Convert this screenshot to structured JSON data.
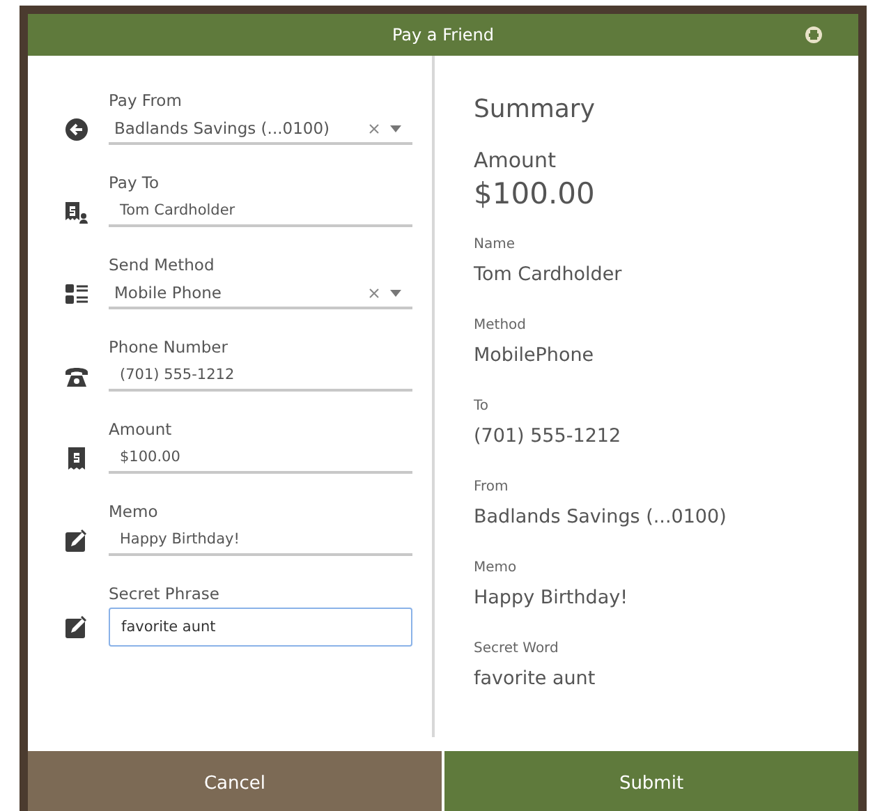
{
  "window": {
    "title": "Pay a Friend"
  },
  "fields": [
    {
      "label": "Pay From",
      "value": "Badlands Savings (...0100)",
      "kind": "select",
      "focused": false
    },
    {
      "label": "Pay To",
      "value": "Tom Cardholder",
      "kind": "text",
      "focused": false
    },
    {
      "label": "Send Method",
      "value": "Mobile Phone",
      "kind": "select",
      "focused": false
    },
    {
      "label": "Phone Number",
      "value": "(701) 555-1212",
      "kind": "text",
      "focused": false
    },
    {
      "label": "Amount",
      "value": "$100.00",
      "kind": "text",
      "focused": false
    },
    {
      "label": "Memo",
      "value": "Happy Birthday!",
      "kind": "text",
      "focused": false
    },
    {
      "label": "Secret Phrase",
      "value": "favorite aunt",
      "kind": "text",
      "focused": true
    }
  ],
  "summary": {
    "title": "Summary",
    "items": [
      {
        "label": "Amount",
        "value": "$100.00",
        "kind": "large"
      },
      {
        "label": "Name",
        "value": "Tom Cardholder",
        "kind": "normal"
      },
      {
        "label": "Method",
        "value": "MobilePhone",
        "kind": "normal"
      },
      {
        "label": "To",
        "value": "(701) 555-1212",
        "kind": "normal"
      },
      {
        "label": "From",
        "value": "Badlands Savings (...0100)",
        "kind": "normal"
      },
      {
        "label": "Memo",
        "value": "Happy Birthday!",
        "kind": "normal"
      },
      {
        "label": "Secret Word",
        "value": "favorite aunt",
        "kind": "normal"
      }
    ]
  },
  "buttons": [
    {
      "label": "Cancel",
      "kind": "secondary"
    },
    {
      "label": "Submit",
      "kind": "primary"
    }
  ]
}
